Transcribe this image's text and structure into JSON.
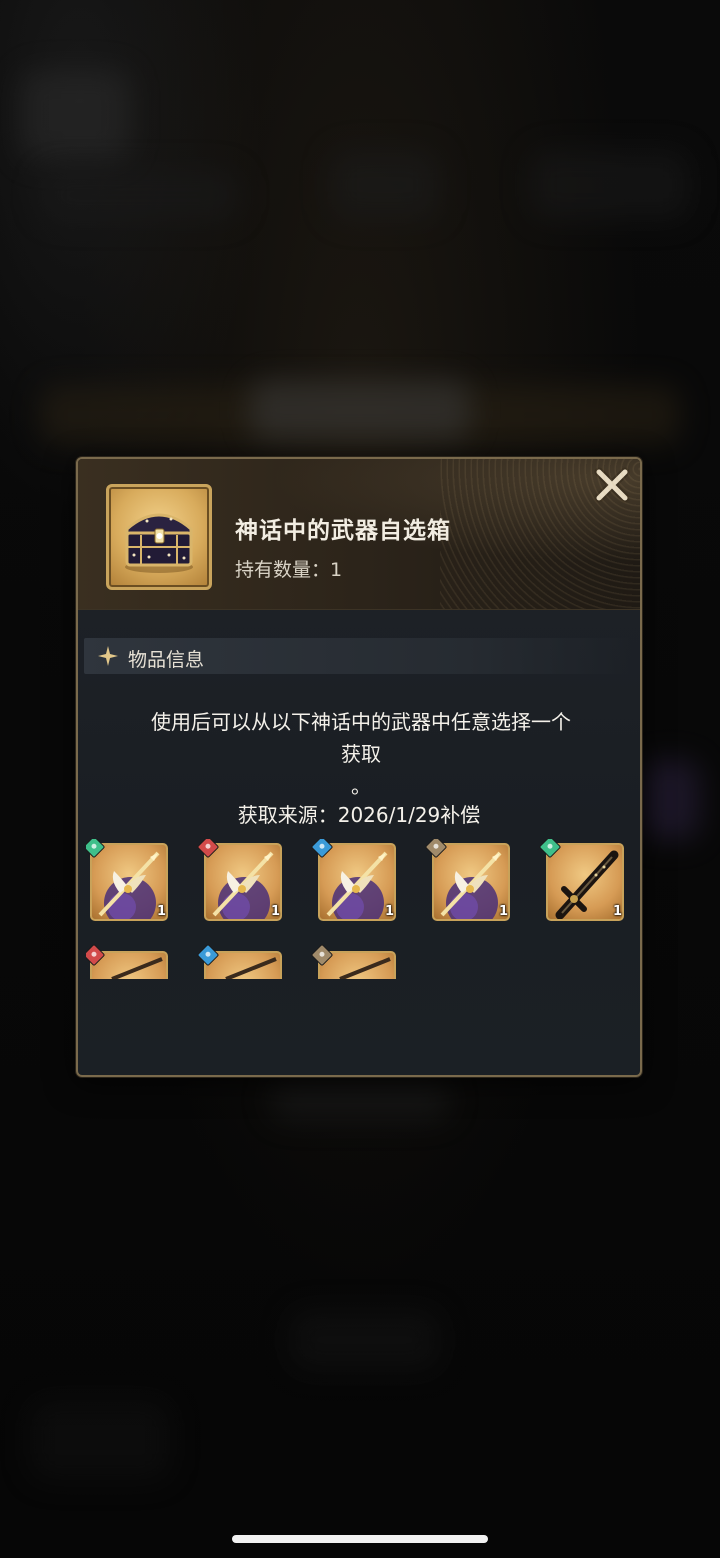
{
  "item": {
    "name": "神话中的武器自选箱",
    "owned_label": "持有数量：",
    "owned_count": "1",
    "icon": "treasure-chest-icon"
  },
  "close_icon": "close-icon",
  "section": {
    "icon": "sparkle-star-icon",
    "title": "物品信息"
  },
  "description": {
    "line1": "使用后可以从以下神话中的武器中任意选择一个",
    "line2": "获取",
    "line3": "。"
  },
  "source": {
    "label": "获取来源：",
    "value": "2026/1/29补偿"
  },
  "rewards": [
    {
      "icon": "golden-spear-icon",
      "element": "wind",
      "element_color": "#3fbf8a",
      "count": "1"
    },
    {
      "icon": "golden-spear-icon",
      "element": "fire",
      "element_color": "#d24a4a",
      "count": "1"
    },
    {
      "icon": "golden-spear-icon",
      "element": "water",
      "element_color": "#3a9ad8",
      "count": "1"
    },
    {
      "icon": "golden-spear-icon",
      "element": "earth",
      "element_color": "#a08a6a",
      "count": "1"
    },
    {
      "icon": "dark-sword-icon",
      "element": "wind",
      "element_color": "#3fbf8a",
      "count": "1"
    },
    {
      "icon": "weapon-icon",
      "element": "fire",
      "element_color": "#d24a4a",
      "count": ""
    },
    {
      "icon": "weapon-icon",
      "element": "water",
      "element_color": "#3a9ad8",
      "count": ""
    },
    {
      "icon": "weapon-icon",
      "element": "earth",
      "element_color": "#a08a6a",
      "count": ""
    }
  ]
}
